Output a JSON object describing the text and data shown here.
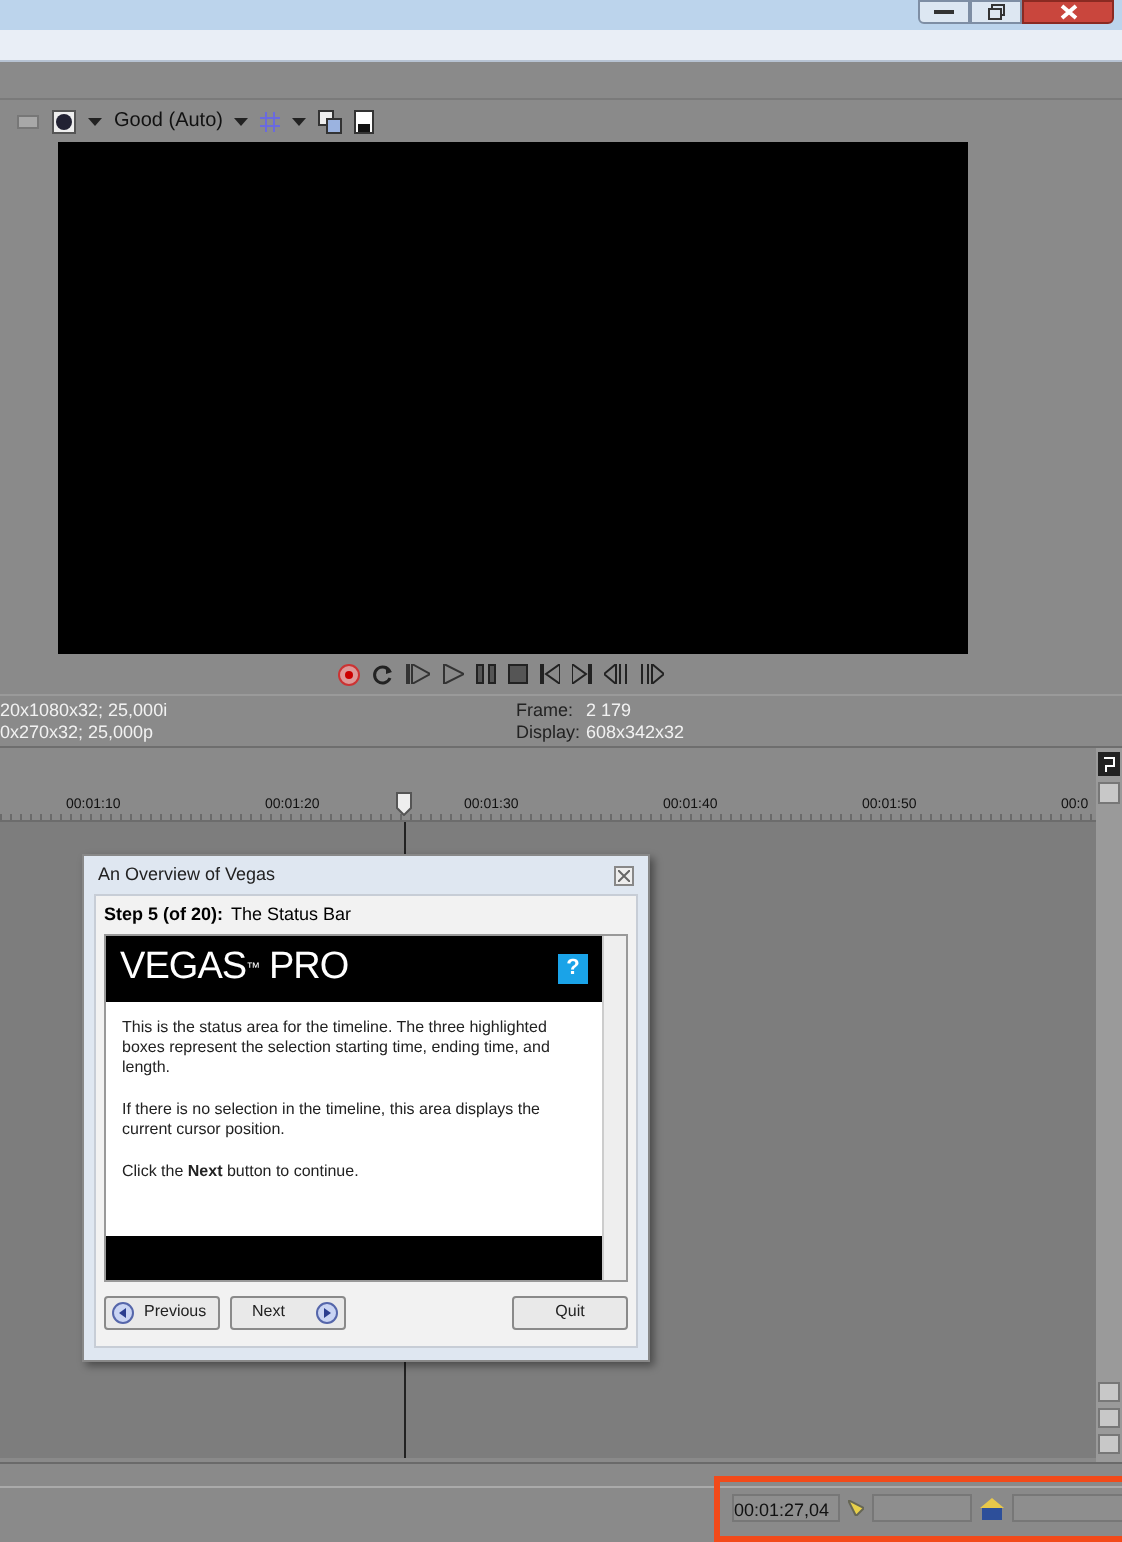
{
  "toolbar": {
    "quality": "Good (Auto)"
  },
  "info": {
    "left_lines": [
      "20x1080x32; 25,000i",
      "0x270x32; 25,000p"
    ],
    "fields": [
      {
        "label": "Frame:",
        "value": "2 179"
      },
      {
        "label": "Display:",
        "value": "608x342x32"
      }
    ]
  },
  "ruler": {
    "ticks": [
      "00:01:10",
      "00:01:20",
      "00:01:30",
      "00:01:40",
      "00:01:50",
      "00:0"
    ]
  },
  "dialog": {
    "title": "An Overview of Vegas",
    "step_label": "Step 5 (of 20):",
    "step_title": "The Status Bar",
    "logo": "VEGAS",
    "logo_mark": "™",
    "logo_suffix": " PRO",
    "help": "?",
    "paragraphs": [
      "This is the status area for the timeline. The three highlighted boxes represent the selection starting time, ending time, and length.",
      "If there is no selection in the timeline, this area displays the current cursor position.",
      "Click the **Next** button to continue."
    ],
    "buttons": [
      {
        "label": "Previous",
        "kind": "back"
      },
      {
        "label": "Next",
        "kind": "forward"
      },
      {
        "label": "Quit",
        "kind": "plain"
      }
    ]
  },
  "status_bar": {
    "start_time": "00:01:27,04"
  }
}
